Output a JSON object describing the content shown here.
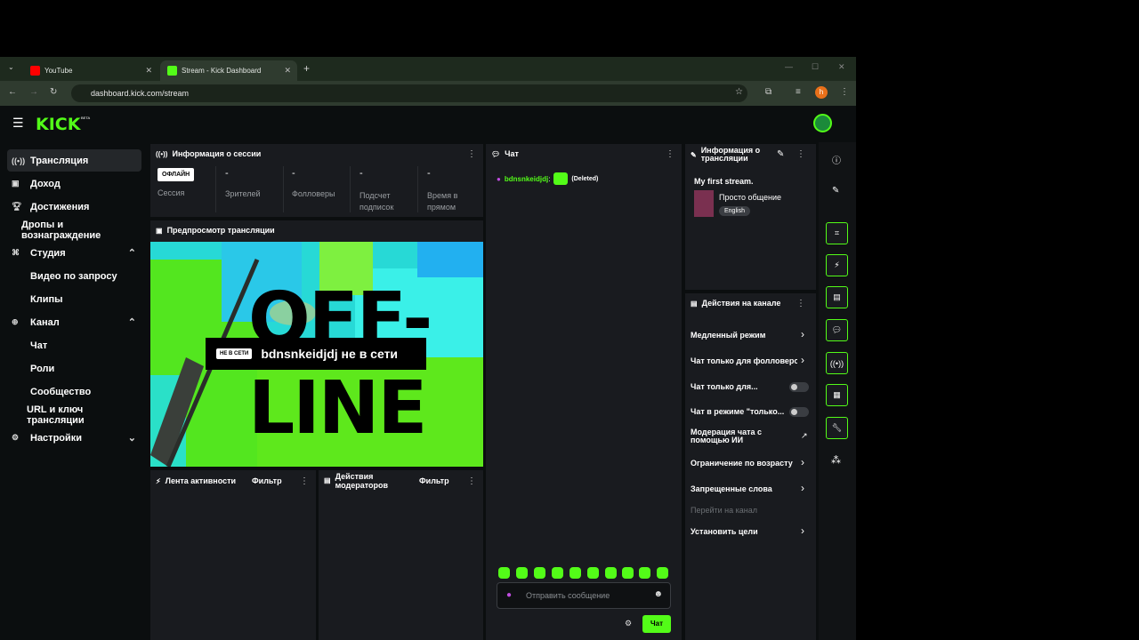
{
  "browser": {
    "tabs": [
      {
        "label": "YouTube"
      },
      {
        "label": "Stream - Kick Dashboard"
      }
    ],
    "url": "dashboard.kick.com/stream",
    "profile_initial": "h"
  },
  "app": {
    "logo": "KICK",
    "logo_badge": "BETA"
  },
  "sidebar": {
    "items": [
      {
        "label": "Трансляция",
        "icon": "broadcast-icon"
      },
      {
        "label": "Доход",
        "icon": "chart-icon"
      },
      {
        "label": "Достижения",
        "icon": "trophy-icon"
      },
      {
        "label": "Дропы и вознаграждение"
      },
      {
        "label": "Студия",
        "icon": "studio-icon"
      },
      {
        "label": "Видео по запросу"
      },
      {
        "label": "Клипы"
      },
      {
        "label": "Канал",
        "icon": "channel-icon"
      },
      {
        "label": "Чат"
      },
      {
        "label": "Роли"
      },
      {
        "label": "Сообщество"
      },
      {
        "label": "URL и ключ трансляции"
      },
      {
        "label": "Настройки",
        "icon": "gear-icon"
      }
    ]
  },
  "session": {
    "title": "Информация о сессии",
    "status": "ОФЛАЙН",
    "stats": [
      {
        "value": "",
        "label": "Сессия"
      },
      {
        "value": "-",
        "label": "Зрителей"
      },
      {
        "value": "-",
        "label": "Фолловеры"
      },
      {
        "value": "-",
        "label": "Подсчет подписок"
      },
      {
        "value": "-",
        "label": "Время в прямом"
      }
    ]
  },
  "preview": {
    "title": "Предпросмотр трансляции",
    "badge": "НЕ В СЕТИ",
    "text": "bdnsnkeidjdj не в сети",
    "bg_word_1": "OFF-",
    "bg_word_2": "LINE"
  },
  "activity": {
    "title": "Лента активности",
    "filter": "Фильтр"
  },
  "modactions": {
    "title": "Действия модераторов",
    "filter": "Фильтр"
  },
  "chat": {
    "title": "Чат",
    "message": {
      "user": "bdnsnkeidjdj",
      "deleted": "(Deleted)"
    },
    "placeholder": "Отправить сообщение",
    "send_label": "Чат"
  },
  "stream_info": {
    "title": "Информация о трансляции",
    "stream_title": "My first stream.",
    "category": "Просто общение",
    "language": "English"
  },
  "channel_actions": {
    "title": "Действия на канале",
    "items": [
      {
        "label": "Медленный режим",
        "control": "arrow"
      },
      {
        "label": "Чат только для фолловеров",
        "control": "arrow"
      },
      {
        "label": "Чат только для...",
        "control": "toggle",
        "on": false
      },
      {
        "label": "Чат в режиме \"только...",
        "control": "toggle",
        "on": false
      },
      {
        "label": "Модерация чата с помощью ИИ",
        "control": "external"
      },
      {
        "label": "Ограничение по возрасту",
        "control": "arrow"
      },
      {
        "label": "Запрещенные слова",
        "control": "arrow"
      },
      {
        "label": "Перейти на канал",
        "control": "none"
      },
      {
        "label": "Установить цели",
        "control": "arrow"
      }
    ]
  },
  "colors": {
    "brand": "#53fc18",
    "panel": "#191b1f",
    "page": "#0b0e0f"
  }
}
